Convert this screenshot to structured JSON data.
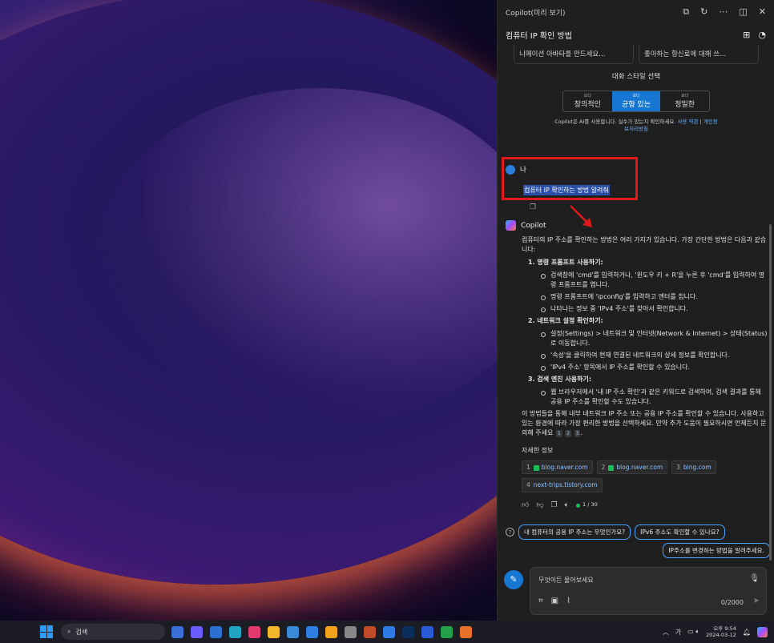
{
  "panel": {
    "title": "Copilot(미리 보기)",
    "conversation_title": "컴퓨터 IP 확인 방법"
  },
  "suggestions": [
    "니메이션 아바타를 만드세요...",
    "좋아하는 항신료에 대해 쓰..."
  ],
  "style": {
    "title": "대화 스타일 선택",
    "small_label": "보다",
    "options": [
      "창의적인",
      "균형 있는",
      "정밀한"
    ],
    "selected": "균형 있는"
  },
  "disclaimer": {
    "text": "Copilot은 AI를 사용합니다. 실수가 있는지 확인하세요.",
    "link1": "사용 약관",
    "link2": "개인정보처리방침"
  },
  "user": {
    "name": "나",
    "message": "컴퓨터 IP 확인하는 방법 알려줘"
  },
  "copilot": {
    "name": "Copilot",
    "intro": "컴퓨터의 IP 주소를 확인하는 방법은 여러 가지가 있습니다. 가장 간단한 방법은 다음과 같습니다:",
    "sections": [
      {
        "title": "1. 명령 프롬프트 사용하기:",
        "items": [
          "검색창에 'cmd'를 입력하거나, '윈도우 키 + R'을 누른 후 'cmd'를 입력하여 명령 프롬프트를 엽니다.",
          "명령 프롬프트에 'ipconfig'를 입력하고 엔터를 칩니다.",
          "나타나는 정보 중 'IPv4 주소'를 찾아서 확인합니다."
        ]
      },
      {
        "title": "2. 네트워크 설정 확인하기:",
        "items": [
          "설정(Settings) > 네트워크 및 인터넷(Network & Internet) > 상태(Status)로 이동합니다.",
          "'속성'을 클릭하여 현재 연결된 네트워크의 상세 정보를 확인합니다.",
          "'IPv4 주소' 항목에서 IP 주소를 확인할 수 있습니다."
        ]
      },
      {
        "title": "3. 검색 엔진 사용하기:",
        "items": [
          "웹 브라우저에서 '내 IP 주소 확인'과 같은 키워드로 검색하여, 검색 결과를 통해 공용 IP 주소를 확인할 수도 있습니다."
        ]
      }
    ],
    "outro": "이 방법들을 통해 내부 네트워크 IP 주소 또는 공용 IP 주소를 확인할 수 있습니다. 사용하고 있는 환경에 따라 가장 편리한 방법을 선택하세요. 만약 추가 도움이 필요하시면 언제든지 문의해 주세요",
    "cites": [
      "1",
      "2",
      "3"
    ],
    "more_info_label": "자세한 정보",
    "refs": [
      {
        "n": "1",
        "label": "blog.naver.com"
      },
      {
        "n": "2",
        "label": "blog.naver.com"
      },
      {
        "n": "3",
        "label": "bing.com"
      },
      {
        "n": "4",
        "label": "next-trips.tistory.com"
      }
    ],
    "turn_count": "1 / 30"
  },
  "followups": [
    "내 컴퓨터의 공용 IP 주소는 무엇인가요?",
    "IPv6 주소도 확인할 수 있나요?",
    "IP주소를 변경하는 방법을 알려주세요."
  ],
  "composer": {
    "placeholder": "무엇이든 물어보세요",
    "counter": "0/2000"
  },
  "taskbar": {
    "search_label": "검색",
    "ime": "가",
    "time": "오후 9:54",
    "date": "2024-03-12"
  }
}
